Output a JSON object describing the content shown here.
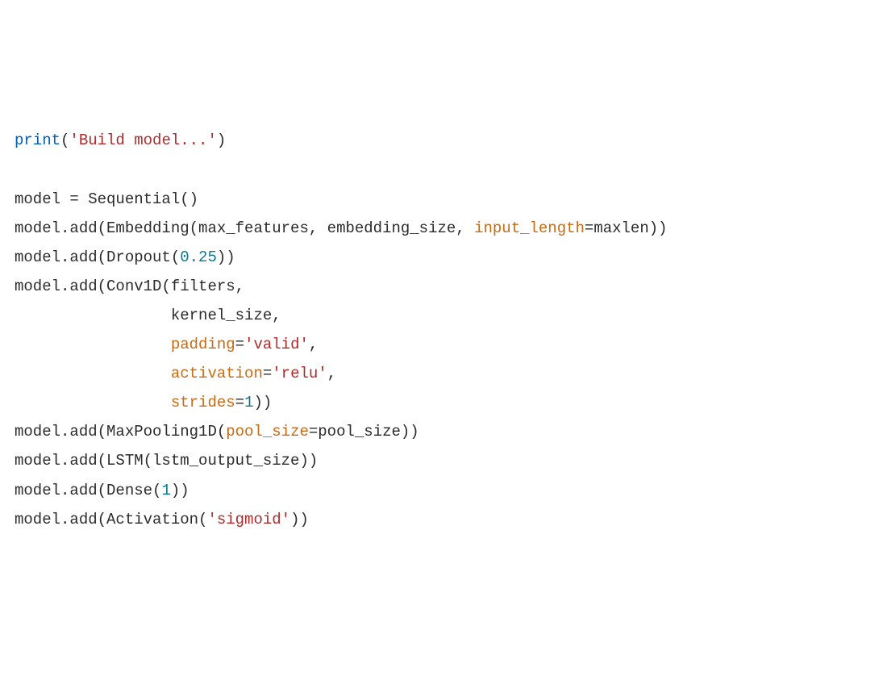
{
  "colors": {
    "default": "#2b2b2b",
    "keyword": "#2a7c2a",
    "builtin": "#005fb8",
    "number": "#0b7a8c",
    "string": "#b02a2a",
    "kwarg": "#c96a14"
  },
  "lines": [
    {
      "indent": 0,
      "tokens": [
        {
          "t": "print",
          "c": "builtin"
        },
        {
          "t": "(",
          "c": "default"
        },
        {
          "t": "'Build model...'",
          "c": "string"
        },
        {
          "t": ")",
          "c": "default"
        }
      ]
    },
    {
      "indent": 0,
      "tokens": []
    },
    {
      "indent": 0,
      "tokens": [
        {
          "t": "model = Sequential()",
          "c": "default"
        }
      ]
    },
    {
      "indent": 0,
      "tokens": [
        {
          "t": "model.add(Embedding(max_features, embedding_size, ",
          "c": "default"
        },
        {
          "t": "input_length",
          "c": "kwarg"
        },
        {
          "t": "=maxlen))",
          "c": "default"
        }
      ]
    },
    {
      "indent": 0,
      "tokens": [
        {
          "t": "model.add(Dropout(",
          "c": "default"
        },
        {
          "t": "0.25",
          "c": "number"
        },
        {
          "t": "))",
          "c": "default"
        }
      ]
    },
    {
      "indent": 0,
      "tokens": [
        {
          "t": "model.add(Conv1D(filters,",
          "c": "default"
        }
      ]
    },
    {
      "indent": 17,
      "tokens": [
        {
          "t": "kernel_size,",
          "c": "default"
        }
      ]
    },
    {
      "indent": 17,
      "tokens": [
        {
          "t": "padding",
          "c": "kwarg"
        },
        {
          "t": "=",
          "c": "default"
        },
        {
          "t": "'valid'",
          "c": "string"
        },
        {
          "t": ",",
          "c": "default"
        }
      ]
    },
    {
      "indent": 17,
      "tokens": [
        {
          "t": "activation",
          "c": "kwarg"
        },
        {
          "t": "=",
          "c": "default"
        },
        {
          "t": "'relu'",
          "c": "string"
        },
        {
          "t": ",",
          "c": "default"
        }
      ]
    },
    {
      "indent": 17,
      "tokens": [
        {
          "t": "strides",
          "c": "kwarg"
        },
        {
          "t": "=",
          "c": "default"
        },
        {
          "t": "1",
          "c": "number"
        },
        {
          "t": "))",
          "c": "default"
        }
      ]
    },
    {
      "indent": 0,
      "tokens": [
        {
          "t": "model.add(MaxPooling1D(",
          "c": "default"
        },
        {
          "t": "pool_size",
          "c": "kwarg"
        },
        {
          "t": "=pool_size))",
          "c": "default"
        }
      ]
    },
    {
      "indent": 0,
      "tokens": [
        {
          "t": "model.add(LSTM(lstm_output_size))",
          "c": "default"
        }
      ]
    },
    {
      "indent": 0,
      "tokens": [
        {
          "t": "model.add(Dense(",
          "c": "default"
        },
        {
          "t": "1",
          "c": "number"
        },
        {
          "t": "))",
          "c": "default"
        }
      ]
    },
    {
      "indent": 0,
      "tokens": [
        {
          "t": "model.add(Activation(",
          "c": "default"
        },
        {
          "t": "'sigmoid'",
          "c": "string"
        },
        {
          "t": "))",
          "c": "default"
        }
      ]
    }
  ]
}
